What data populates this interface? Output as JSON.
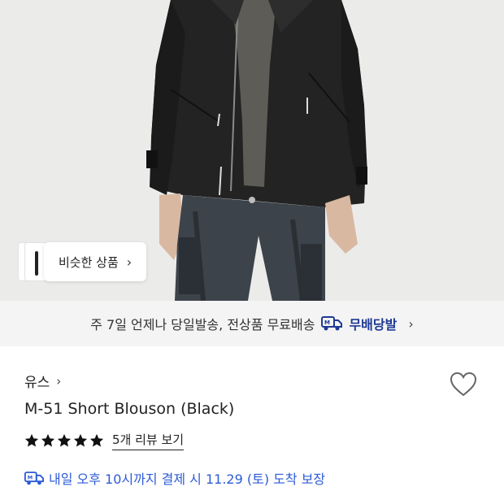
{
  "similar_products": {
    "label": "비슷한 상품",
    "chevron": "›"
  },
  "shipping_banner": {
    "text": "주 7일 언제나 당일발송, 전상품 무료배송",
    "brand_label": "무배당발",
    "chevron": "›",
    "icon": "truck-icon"
  },
  "product": {
    "brand": "유스",
    "brand_chevron": "›",
    "name": "M-51 Short Blouson (Black)",
    "rating_stars": 5,
    "reviews_label": "5개 리뷰 보기",
    "wishlist_icon": "heart-icon"
  },
  "delivery": {
    "text": "내일 오후 10시까지 결제 시 11.29 (토) 도착 보장",
    "icon": "truck-icon"
  },
  "colors": {
    "brand_blue": "#1f3a93",
    "delivery_blue": "#2d5bd7",
    "banner_bg": "#f4f4f4",
    "hero_bg": "#ebebea"
  }
}
